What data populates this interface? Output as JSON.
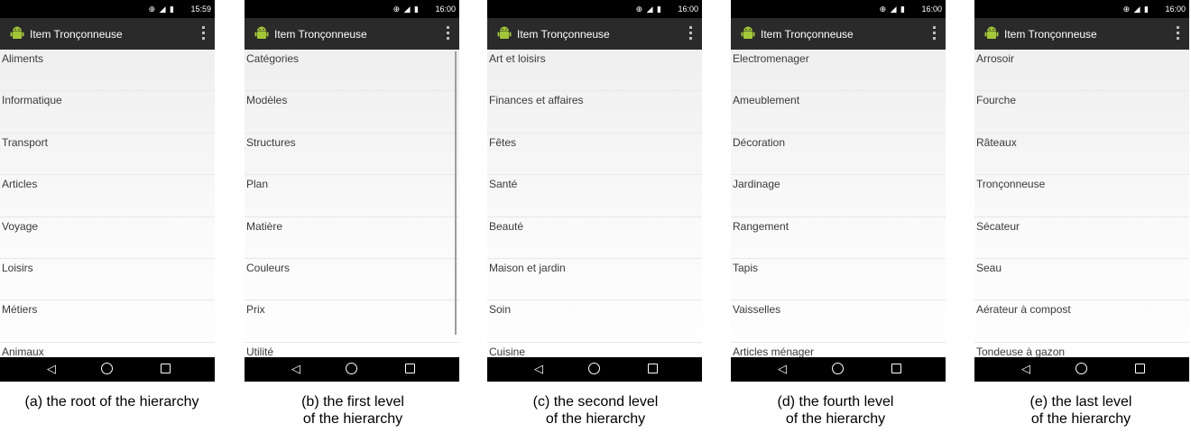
{
  "app_title": "Item Tronçonneuse",
  "status_icons": "⊕ ◢ ▮",
  "nav": {
    "back": "◁",
    "home": "circle",
    "recent": "square"
  },
  "screens": [
    {
      "time": "15:59",
      "items": [
        "Aliments",
        "Informatique",
        "Transport",
        "Articles",
        "Voyage",
        "Loisirs",
        "Métiers",
        "Animaux"
      ],
      "caption": "(a) the root of the hierarchy"
    },
    {
      "time": "16:00",
      "items": [
        "Catégories",
        "Modèles",
        "Structures",
        "Plan",
        "Matière",
        "Couleurs",
        "Prix",
        "Utilité"
      ],
      "caption_line1": "(b) the first level",
      "caption_line2": "of the hierarchy"
    },
    {
      "time": "16:00",
      "items": [
        "Art et loisirs",
        "Finances et affaires",
        "Fêtes",
        "Santé",
        "Beauté",
        "Maison et jardin",
        "Soin",
        "Cuisine"
      ],
      "caption_line1": "(c) the second level",
      "caption_line2": "of the hierarchy"
    },
    {
      "time": "16:00",
      "items": [
        "Electromenager",
        "Ameublement",
        "Décoration",
        "Jardinage",
        "Rangement",
        "Tapis",
        "Vaisselles",
        "Articles ménager"
      ],
      "caption_line1": "(d) the fourth level",
      "caption_line2": "of the hierarchy"
    },
    {
      "time": "16:00",
      "items": [
        "Arrosoir",
        "Fourche",
        "Râteaux",
        "Tronçonneuse",
        "Sécateur",
        "Seau",
        "Aérateur à compost",
        "Tondeuse à gazon"
      ],
      "caption_line1": "(e) the last level",
      "caption_line2": "of the hierarchy"
    }
  ]
}
